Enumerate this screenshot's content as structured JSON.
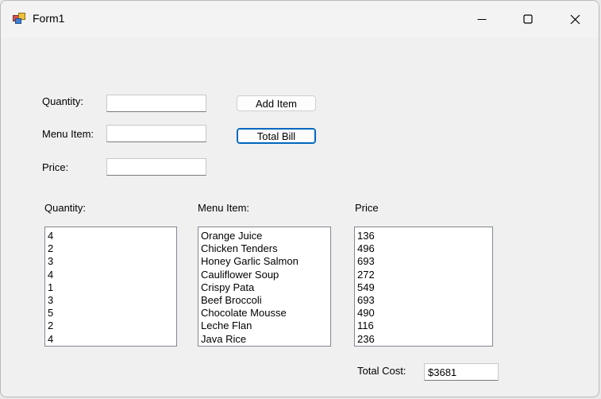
{
  "window": {
    "title": "Form1"
  },
  "form": {
    "quantity_label": "Quantity:",
    "menu_item_label": "Menu Item:",
    "price_label": "Price:",
    "quantity_value": "",
    "menu_item_value": "",
    "price_value": "",
    "add_item_label": "Add Item",
    "total_bill_label": "Total Bill"
  },
  "lists": {
    "quantity_header": "Quantity:",
    "menu_item_header": "Menu Item:",
    "price_header": "Price",
    "quantities": [
      "4",
      "2",
      "3",
      "4",
      "1",
      "3",
      "5",
      "2",
      "4"
    ],
    "menu_items": [
      "Orange Juice",
      "Chicken Tenders",
      "Honey Garlic Salmon",
      "Cauliflower Soup",
      "Crispy Pata",
      "Beef Broccoli",
      "Chocolate Mousse",
      "Leche Flan",
      "Java Rice"
    ],
    "prices": [
      "136",
      "496",
      "693",
      "272",
      "549",
      "693",
      "490",
      "116",
      "236"
    ]
  },
  "total": {
    "label": "Total Cost:",
    "value": "$3681"
  },
  "icons": {
    "app": "winforms-app-icon",
    "minimize": "minimize-icon",
    "maximize": "maximize-icon",
    "close": "close-icon"
  }
}
